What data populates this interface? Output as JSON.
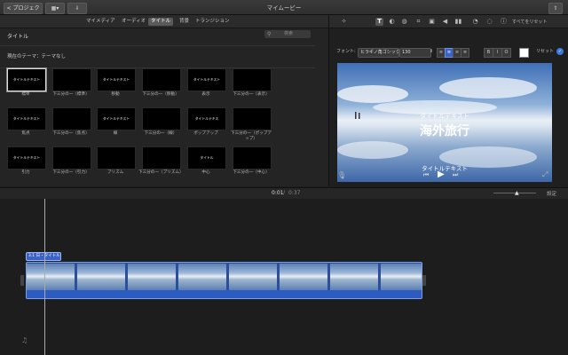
{
  "window": {
    "title": "マイムービー",
    "back_label": "< プロジェクト"
  },
  "browser": {
    "tabs": [
      "マイメディア",
      "オーディオ",
      "タイトル",
      "背景",
      "トランジション"
    ],
    "active_tab": 2,
    "section_title": "タイトル",
    "search_placeholder": "検索",
    "current_theme": "現在のテーマ：テーマなし",
    "titles": [
      {
        "label": "標準",
        "text": "タイトルテキスト"
      },
      {
        "label": "下三分の一（標準）",
        "text": ""
      },
      {
        "label": "移動",
        "text": "タイトルテキスト"
      },
      {
        "label": "下三分の一（移動）",
        "text": ""
      },
      {
        "label": "表示",
        "text": "タイトルテキスト"
      },
      {
        "label": "下三分の一（表示）",
        "text": ""
      },
      {
        "label": "焦点",
        "text": "タイトルテキスト"
      },
      {
        "label": "下三分の一（焦点）",
        "text": ""
      },
      {
        "label": "線",
        "text": "タイトルテキスト"
      },
      {
        "label": "下三分の一（線）",
        "text": ""
      },
      {
        "label": "ポップアップ",
        "text": "タイトルテキス"
      },
      {
        "label": "下三分の一（ポップアップ）",
        "text": ""
      },
      {
        "label": "引力",
        "text": "タイトルテキスト"
      },
      {
        "label": "下三分の一（引力）",
        "text": ""
      },
      {
        "label": "プリズム",
        "text": ""
      },
      {
        "label": "下三分の一（プリズム）",
        "text": ""
      },
      {
        "label": "中心",
        "text": "タイトル"
      },
      {
        "label": "下三分の一（中心）",
        "text": ""
      }
    ]
  },
  "viewer": {
    "reset_all": "すべてをリセット",
    "font_label": "フォント:",
    "font_name": "ヒラギノ角ゴシック W",
    "font_size": "130",
    "bold": "B",
    "italic": "I",
    "outline": "O",
    "reset": "リセット",
    "preview_title_small": "タイトルテキスト",
    "preview_title_big": "海外旅行",
    "preview_caption": "タイトルテキスト"
  },
  "timeline": {
    "current_time": "0:01",
    "separator": "/",
    "total_time": "0:37",
    "settings_label": "設定",
    "title_clip_label": "3.1 日・タイトル"
  },
  "colors": {
    "accent": "#3a62c7",
    "clip_border": "#7aa0e8"
  }
}
